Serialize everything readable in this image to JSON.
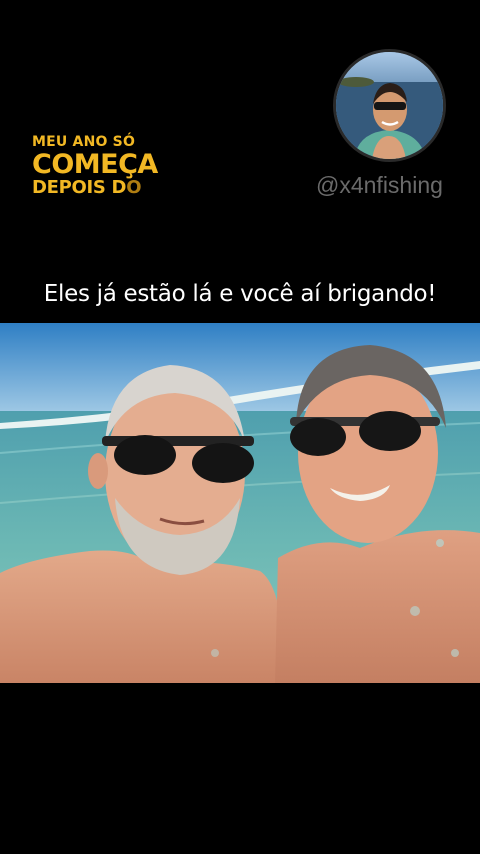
{
  "overlay": {
    "line1": "MEU ANO SÓ",
    "line2": "COMEÇA",
    "line3_main": "DEPOIS D",
    "line3_fade": "O"
  },
  "profile": {
    "handle": "@x4nfishing",
    "avatar_icon": "profile-photo"
  },
  "caption": "Eles já estão lá e você aí brigando!",
  "colors": {
    "background": "#000000",
    "accent_gold": "#f2b824",
    "handle_gray": "#6b6b6b"
  }
}
